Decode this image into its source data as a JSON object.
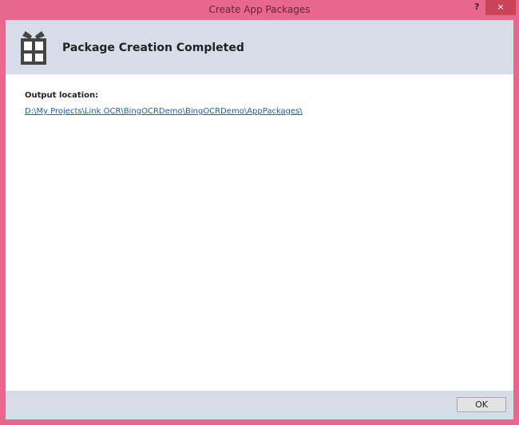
{
  "window": {
    "title": "Create App Packages",
    "help_label": "?",
    "close_label": "×"
  },
  "header": {
    "title": "Package Creation Completed",
    "icon": "gift-package-icon"
  },
  "content": {
    "output_label": "Output location:",
    "output_path": "D:\\My Projects\\Link OCR\\BingOCRDemo\\BingOCRDemo\\AppPackages\\"
  },
  "footer": {
    "ok_label": "OK"
  }
}
